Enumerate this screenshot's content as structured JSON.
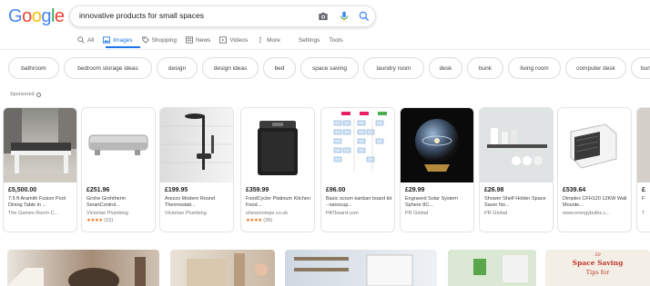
{
  "logo": {
    "letters": [
      "G",
      "o",
      "o",
      "g",
      "l",
      "e"
    ],
    "colors": [
      "#4285f4",
      "#ea4335",
      "#fbbc05",
      "#4285f4",
      "#34a853",
      "#ea4335"
    ]
  },
  "search": {
    "query": "innovative products for small spaces"
  },
  "tabs": [
    {
      "label": "All",
      "icon": "search-icon"
    },
    {
      "label": "Images",
      "icon": "image-icon",
      "active": true
    },
    {
      "label": "Shopping",
      "icon": "tag-icon"
    },
    {
      "label": "News",
      "icon": "newspaper-icon"
    },
    {
      "label": "Videos",
      "icon": "video-icon"
    },
    {
      "label": "More",
      "icon": "more-icon"
    },
    {
      "label": "Settings"
    },
    {
      "label": "Tools"
    }
  ],
  "chips": [
    "bathroom",
    "bedroom storage ideas",
    "design",
    "design ideas",
    "bed",
    "space saving",
    "laundry room",
    "desk",
    "bunk",
    "living room",
    "computer desk",
    "bunk"
  ],
  "sponsored": "Sponsored",
  "products": [
    {
      "price": "£5,500.00",
      "title": "7.5 ft Aramith Fusion Pool Dining Table in ...",
      "seller": "The Games Room C..."
    },
    {
      "price": "£251.96",
      "title": "Grohe Grohtherm SmartControl...",
      "seller": "Victorian Plumbing",
      "stars": "★★★★",
      "rating": "(15)"
    },
    {
      "price": "£199.95",
      "title": "Arezzo Modern Round Thermostati...",
      "seller": "Victorian Plumbing"
    },
    {
      "price": "£359.99",
      "title": "FoodCycler Platinum Kitchen Food...",
      "seller": "shesenompe.co.uk",
      "stars": "★★★★",
      "rating": "(39)"
    },
    {
      "price": "£96.00",
      "title": "Basic scrum kanban board kit - nanocup...",
      "seller": "PATboard.com"
    },
    {
      "price": "£29.99",
      "title": "Engraved Solar System Sphere 8C...",
      "seller": "PR Global"
    },
    {
      "price": "£26.98",
      "title": "Shower Shelf Holder Space Saver No...",
      "seller": "PR Global"
    },
    {
      "price": "£539.64",
      "title": "Dimplex CFH120 12KW Wall Mounte...",
      "seller": "www.energybulbs.c..."
    },
    {
      "price": "£",
      "title": "F",
      "seller": "T"
    }
  ],
  "thumbs": [
    {
      "text": ""
    },
    {
      "text": ""
    },
    {
      "text": ""
    },
    {
      "text": ""
    },
    {
      "text": ""
    },
    {
      "line1": "50",
      "line2": "Space Saving",
      "line3": "Tips for"
    }
  ],
  "colors": {
    "accent": "#1a73e8",
    "star": "#e7711b"
  }
}
